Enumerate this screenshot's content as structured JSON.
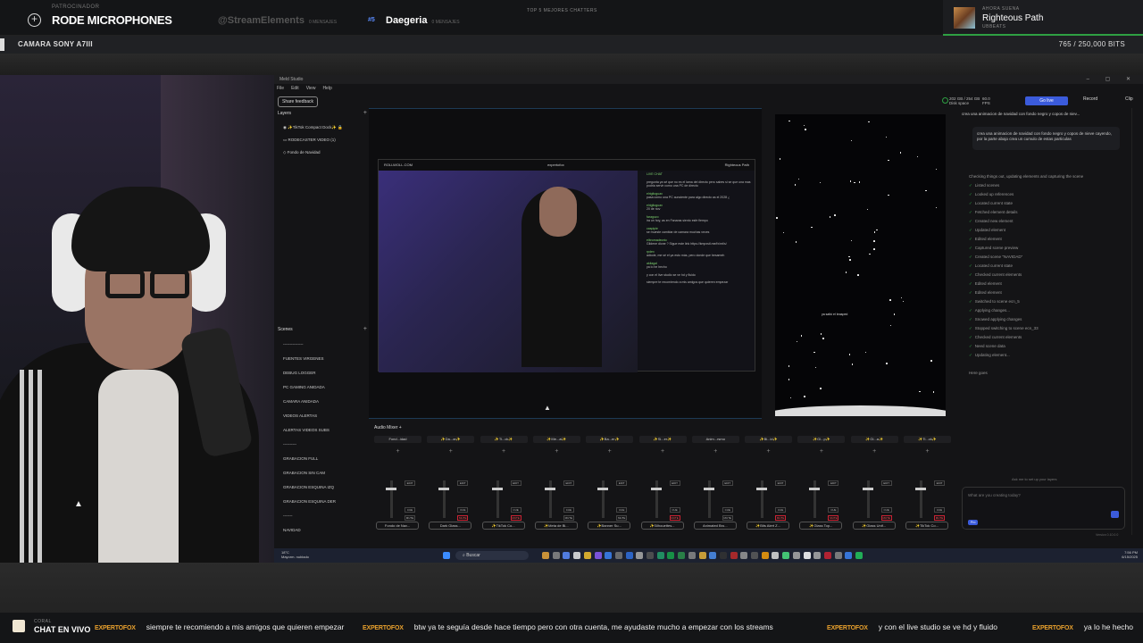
{
  "overlay": {
    "sponsor_caption": "PATROCINADOR",
    "sponsor_name": "RODE MICROPHONES",
    "top_chatters_label": "TOP 5 MEJORES CHATTERS",
    "chatters": [
      {
        "rank": "",
        "name": "@StreamElements",
        "count": "0 MENSAJES"
      },
      {
        "rank": "#5",
        "name": "Daegeria",
        "count": "0 MENSAJES"
      }
    ],
    "now_playing": {
      "caption": "AHORA SUENA",
      "title": "Righteous Path",
      "artist": "UBBEATS"
    },
    "camera_label": "CAMARA SONY A7III",
    "bits": "765 / 250,000 BITS",
    "chat_caption": "CORAL",
    "chat_title": "CHAT EN VIVO",
    "ticker": [
      {
        "user": "EXPERTOFOX",
        "text": "siempre te recomiendo a mis amigos que quieren empezar"
      },
      {
        "user": "EXPERTOFOX",
        "text": "btw ya te seguía desde hace tiempo pero con otra cuenta, me ayudaste mucho a empezar con los streams"
      },
      {
        "user": "EXPERTOFOX",
        "text": "y con el live studio se ve hd y fluido"
      },
      {
        "user": "EXPERTOFOX",
        "text": "ya lo he hecho"
      }
    ]
  },
  "app": {
    "title": "Meld Studio",
    "menu": [
      "File",
      "Edit",
      "View",
      "Help"
    ],
    "share_feedback": "Share feedback",
    "disk": {
      "value": "202 GB / 254 GB",
      "label": "Disk space"
    },
    "fps": {
      "value": "60.0",
      "label": "FPS"
    },
    "go_live": "Go live",
    "record": "Record",
    "clip": "Clip",
    "layers_title": "Layers",
    "layers": [
      "✨TikTok Compact Dock✨",
      "RODECASTER VIDEO (1)",
      "Fondo de Navidad"
    ],
    "scenes_title": "Scenes",
    "scenes": [
      "---------------",
      "FUENTES VIRGENES",
      "DEBUG LOGGER",
      "PC GAMING ANIDADA",
      "CAMARA ANIDADA",
      "VIDEOS ALERTAS",
      "ALERTAS VIDEOS SUBS",
      "----------",
      "GRABACION FULL",
      "GRABACION SIN CAM",
      "GRABACION ESQUINA IZQ",
      "GRABACION ESQUINA DER",
      "-------",
      "NAVIDAD"
    ],
    "canvas": {
      "site": "ROLLWOLL.COM",
      "handle": "expertofox",
      "song": "Righteous Path",
      "camera": "CAMARA SONY A7III",
      "chat": [
        {
          "u": "LIVE CHAT",
          "t": ""
        },
        {
          "u": "",
          "t": "pregunta ya sé que no es el lama del directo pero sabes si se que una mas podria servir como una PC de directo"
        },
        {
          "u": "elrigltoguax",
          "t": "pasa como una PC aunciente para algo directo as el 2028 ¿"
        },
        {
          "u": "elrigltoguax",
          "t": "20 de nov"
        },
        {
          "u": "faraguzo",
          "t": "ira un hoy, as en Fanaras siento esfe fiempo"
        },
        {
          "u": "caspipie",
          "t": "se mueste cambiar de camara muchas veces"
        },
        {
          "u": "elbromadeonic",
          "t": "Gildene dione ? Sigue este link https://kmpxstl.me/fx/mt/s/"
        },
        {
          "u": "rpdex",
          "t": "adiode, me sé el ya esto más, pero donde que besameh"
        },
        {
          "u": "akilagal",
          "t": "ya lo he hecho"
        },
        {
          "u": "",
          "t": "y con el live studio se ve hd y fluido"
        },
        {
          "u": "",
          "t": "siempre te recomiendo a mis amigos que quieren empezar"
        }
      ]
    },
    "preview_text": "ya saltó el brasped",
    "mixer_title": "Audio Mixer",
    "mixer": [
      {
        "name": "Fond...idad",
        "source": "Fondo de Nav..."
      },
      {
        "name": "✨Da...ar✨",
        "source": "Dark Glass..."
      },
      {
        "name": "✨Ti...ck✨",
        "source": "✨TikTok Co..."
      },
      {
        "name": "✨Me...al✨",
        "source": "✨Meta de Bi..."
      },
      {
        "name": "✨Ba...er✨",
        "source": "✨Banner Su..."
      },
      {
        "name": "✨Si...er✨",
        "source": "✨Silhouettes..."
      },
      {
        "name": "Anim...rsmo",
        "source": "Animated Bro..."
      },
      {
        "name": "✨Bi...ld✨",
        "source": "✨Bits Alert Z..."
      },
      {
        "name": "✨Gl...p✨",
        "source": "✨Glass Top..."
      },
      {
        "name": "✨Gl...a✨",
        "source": "✨Glass Unif..."
      },
      {
        "name": "✨Ti...ck✨",
        "source": "✨TikTok Co..."
      }
    ],
    "ai": {
      "header": "crea una animacion de navidad con fondo negro y copos de niev...",
      "message": "crea una animacion de navidad con fondo negro y copos de nieve cayendo, por la parte abajo crea un cumulo de estas particulas",
      "steps": [
        "Checking things out, updating elements and capturing the scene",
        "Listed scenes",
        "Looked up references",
        "Located current state",
        "Fetched element details",
        "Created new element",
        "Updated element",
        "Edited element",
        "Captured scene preview",
        "Created scene \"NAVIDAD\"",
        "Located current state",
        "Checked current elements",
        "Edited element",
        "Edited element",
        "Switched to scene ecn_5",
        "Applying changes...",
        "Snowed applying changes",
        "Stopped switching to scene ecn_33",
        "Checked current elements",
        "Need scene data",
        "Updating element..."
      ],
      "thinking": "Here goes",
      "hint": "Ask me to set up your layers",
      "placeholder": "What are you creating today?",
      "plan": "Pro",
      "version": "Version 0.10.0.0"
    },
    "taskbar": {
      "temp": "18°C",
      "weather": "Mayorm. nublado",
      "search": "Buscar",
      "time": "7:56 PM",
      "date": "6/15/2025"
    }
  }
}
